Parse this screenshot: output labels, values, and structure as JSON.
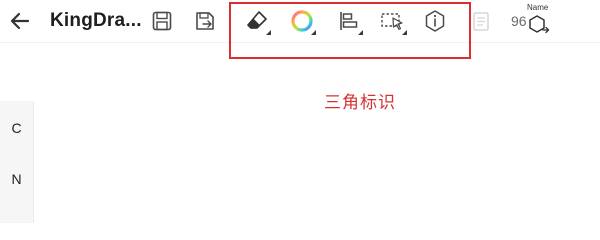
{
  "header": {
    "title": "KingDra...",
    "count": "96",
    "name_label": "Name"
  },
  "toolbar": {
    "icons": [
      "back-arrow-icon",
      "save-icon",
      "save-as-icon",
      "eraser-icon",
      "color-wheel-icon",
      "align-icon",
      "lasso-select-icon",
      "info-hexagon-icon",
      "document-icon",
      "name-structure-icon"
    ]
  },
  "annotation": {
    "text": "三角标识"
  },
  "side_panel": {
    "items": [
      "C",
      "N"
    ]
  },
  "colors": {
    "highlight": "#d9302f",
    "icon": "#4a4a4a",
    "faded_icon": "#d6d6d6"
  }
}
